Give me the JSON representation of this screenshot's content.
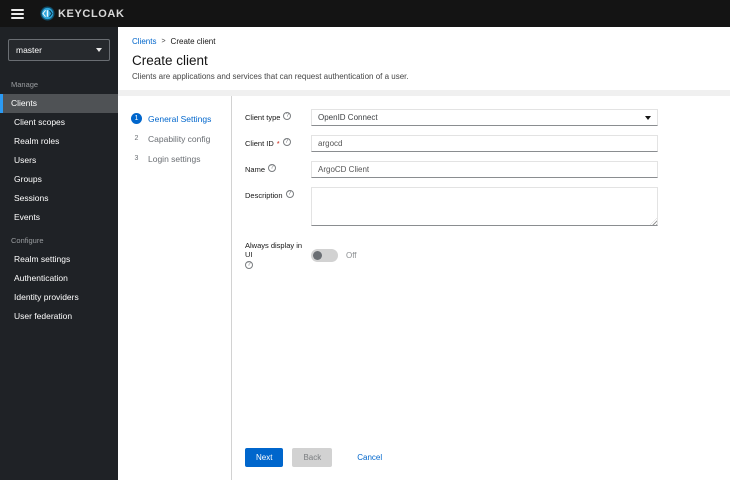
{
  "topbar": {
    "brand": "KEYCLOAK"
  },
  "sidebar": {
    "realm_selector": {
      "value": "master"
    },
    "sections": [
      {
        "header": "Manage",
        "items": [
          "Clients",
          "Client scopes",
          "Realm roles",
          "Users",
          "Groups",
          "Sessions",
          "Events"
        ]
      },
      {
        "header": "Configure",
        "items": [
          "Realm settings",
          "Authentication",
          "Identity providers",
          "User federation"
        ]
      }
    ],
    "selected_item": "Clients"
  },
  "breadcrumb": {
    "link": "Clients",
    "separator": ">",
    "current": "Create client"
  },
  "header": {
    "title": "Create client",
    "subtitle": "Clients are applications and services that can request authentication of a user."
  },
  "wizard": {
    "steps": [
      {
        "number": "1",
        "label": "General Settings",
        "active": true
      },
      {
        "number": "2",
        "label": "Capability config",
        "active": false
      },
      {
        "number": "3",
        "label": "Login settings",
        "active": false
      }
    ],
    "form": {
      "client_type": {
        "label": "Client type",
        "value": "OpenID Connect"
      },
      "client_id": {
        "label": "Client ID",
        "required_mark": "*",
        "value": "argocd"
      },
      "name": {
        "label": "Name",
        "value": "ArgoCD Client"
      },
      "description": {
        "label": "Description",
        "value": ""
      },
      "always_display": {
        "label": "Always display in UI",
        "state": "Off"
      },
      "help_glyph": "?"
    },
    "footer": {
      "next": "Next",
      "back": "Back",
      "cancel": "Cancel"
    }
  },
  "colors": {
    "accent_blue": "#0066cc",
    "topbar_bg": "#141414",
    "sidebar_bg": "#1f2226",
    "selected_nav_bg": "#4f5255",
    "selected_nav_border": "#2b9af3",
    "logo_cyan": "#2fa7dc"
  }
}
